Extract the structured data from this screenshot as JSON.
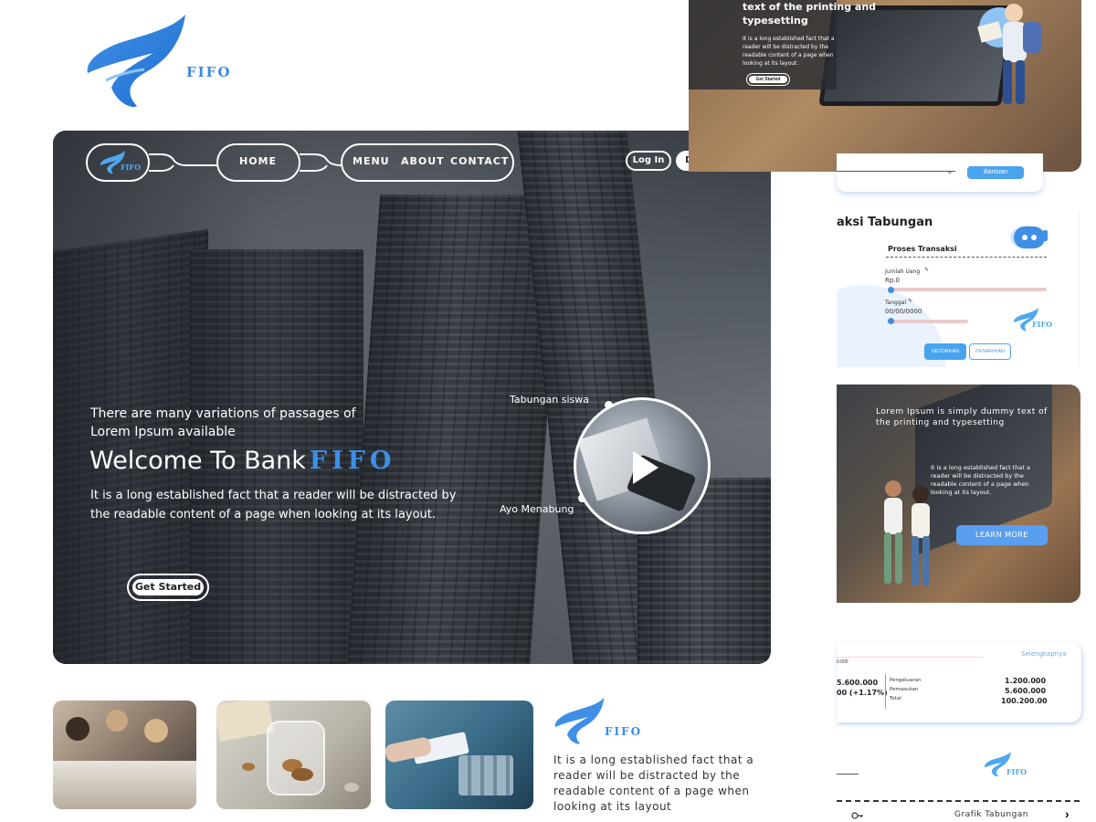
{
  "brand": {
    "name": "FIFO",
    "accent": "#3b8be0"
  },
  "hero": {
    "nav": {
      "home": "HOME",
      "menu": "MENU",
      "about": "ABOUT",
      "contact": "CONTACT",
      "login": "Log In",
      "register": "Daftar",
      "logo_text": "FIFO"
    },
    "subtitle": "There are many variations of passages of Lorem Ipsum available",
    "title": "Welcome To Bank",
    "title_accent": "FIFO",
    "description": "It is a long established fact that a reader will be distracted by the readable content of a page when looking at its layout.",
    "cta": "Get Started",
    "video": {
      "icon": "play-icon",
      "label_top": "Tabungan siswa",
      "label_bottom": "Ayo Menabung"
    }
  },
  "footer": {
    "logo_text": "FIFO",
    "text": "It is a long established fact that a reader will be distracted by the readable content of a page when looking at its layout"
  },
  "mockups": {
    "top": {
      "title": "text of the printing and typesetting",
      "body": "It is a long established fact that a reader will be distracted by the readable content of a page when looking at its layout.",
      "cta": "Get Started",
      "help_button": "Bantuan"
    },
    "transaction": {
      "title": "aksi Tabungan",
      "section": "Proses Transaksi",
      "amount_label": "Jumlah Uang",
      "amount_value": "Rp.0",
      "date_label": "Tanggal",
      "date_value": "00/00/0000",
      "deposit": "SETORKAN",
      "withdraw": "PENARIKAN",
      "logo_text": "FIFO"
    },
    "promo": {
      "title": "Lorem Ipsum is simply dummy text of the printing and typesetting",
      "body": "It is a long established fact that a reader will be distracted by the readable content of a page when looking at its layout.",
      "cta": "LEARN MORE"
    },
    "stats": {
      "more": "Selengkapnya",
      "axis_small": "0.000",
      "balance": "5.600.000",
      "change": "00 (+1.17%)",
      "rows": [
        {
          "label": "Pengeluaran",
          "value": "1.200.000"
        },
        {
          "label": "Pemasukan",
          "value": "5.600.000"
        },
        {
          "label": "Total",
          "value": "100.200.00"
        }
      ]
    },
    "bottom": {
      "logo_text": "FIFO",
      "chart_link": "Grafik Tabungan"
    }
  }
}
